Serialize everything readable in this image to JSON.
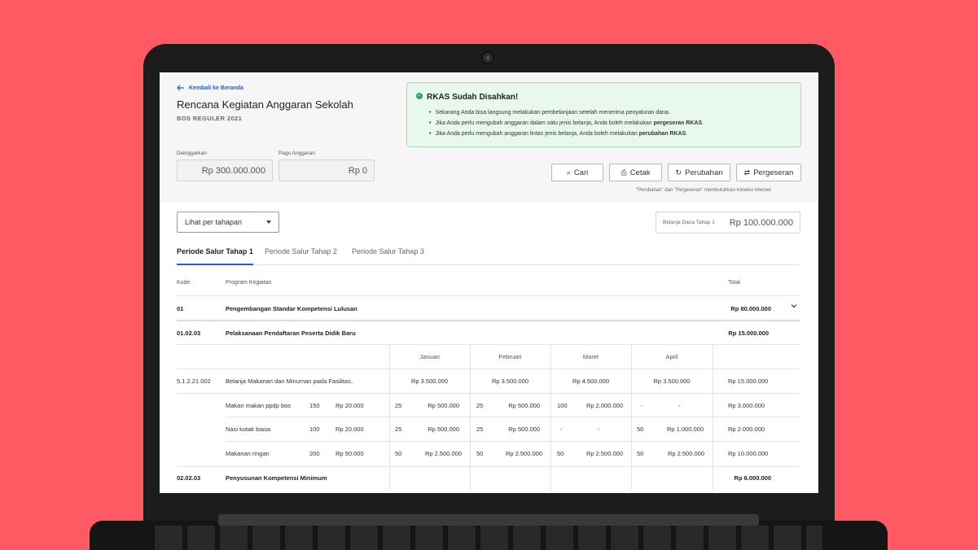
{
  "header": {
    "back_label": "Kembali ke Beranda",
    "title": "Rencana Kegiatan Anggaran Sekolah",
    "subtitle": "BOS REGULER 2021"
  },
  "budget": {
    "planned_label": "Dianggarkan",
    "planned_value": "Rp 300.000.000",
    "ceiling_label": "Pagu Anggaran",
    "ceiling_value": "Rp 0"
  },
  "alert": {
    "title": "RKAS Sudah Disahkan!",
    "items": [
      "Sekarang Anda bisa langsung melakukan pembelanjaan setelah menerima penyaluran dana.",
      "Jika Anda perlu mengubah anggaran dalam satu jenis belanja, Anda boleh melakukan pergeseran RKAS.",
      "Jika Anda perlu mengubah anggaran lintas jenis belanja, Anda boleh melakukan perubahan RKAS."
    ],
    "accent": "#27a65a"
  },
  "toolbar": {
    "search_label": "Cari",
    "print_label": "Cetak",
    "change_label": "Perubahan",
    "shift_label": "Pergeseran",
    "note": "\"Perubahan\" dan \"Pergeseran\" membutuhkan koneksi internet"
  },
  "filter": {
    "select_value": "Lihat per tahapan"
  },
  "stage_total": {
    "label": "Belanja Dana Tahap 1",
    "value": "Rp 100.000.000"
  },
  "tabs": [
    "Periode Salur Tahap 1",
    "Periode Salur Tahap 2",
    "Periode Salur Tahap 3"
  ],
  "table": {
    "headers": {
      "code": "Kode",
      "program": "Program Kegiatan",
      "total": "Total"
    },
    "months": [
      "Januari",
      "Februari",
      "Maret",
      "April"
    ],
    "program": {
      "code": "01",
      "name": "Pengembangan Standar Kompetensi Lulusan",
      "total": "Rp 80.000.000"
    },
    "activity": {
      "code": "01.02.03",
      "name": "Pelaksanaan Pendaftaran Peserta Didik Baru",
      "total": "Rp 15.000.000"
    },
    "expense": {
      "code": "5.1.2.21.002",
      "name": "Belanja Makanan dan Minuman pada Fasilitas..",
      "month_totals": [
        "Rp 3.500.000",
        "Rp 3.500.000",
        "Rp 4.500.000",
        "Rp 3.500.000"
      ],
      "total": "Rp 15.000.000"
    },
    "items": [
      {
        "name": "Makan makan ppdp bos",
        "qty": "150",
        "price": "Rp 20.000",
        "m": [
          [
            "25",
            "Rp 500.000"
          ],
          [
            "25",
            "Rp 500.000"
          ],
          [
            "100",
            "Rp 2.000.000"
          ],
          [
            "-",
            "-"
          ]
        ],
        "total": "Rp 3.000.000"
      },
      {
        "name": "Nasi kotak biasa",
        "qty": "100",
        "price": "Rp 20.000",
        "m": [
          [
            "25",
            "Rp 500.000"
          ],
          [
            "25",
            "Rp 500.000"
          ],
          [
            "-",
            "-"
          ],
          [
            "50",
            "Rp 1.000.000"
          ]
        ],
        "total": "Rp 2.000.000"
      },
      {
        "name": "Makanan ringan",
        "qty": "200",
        "price": "Rp 50.000",
        "m": [
          [
            "50",
            "Rp 2.500.000"
          ],
          [
            "50",
            "Rp 2.500.000"
          ],
          [
            "50",
            "Rp 2.500.000"
          ],
          [
            "50",
            "Rp 2.500.000"
          ]
        ],
        "total": "Rp 10.000.000"
      }
    ],
    "next_activity": {
      "code": "02.02.03",
      "name": "Penyusunan Kompetensi Minimum",
      "total": "Rp 6.000.000"
    }
  }
}
